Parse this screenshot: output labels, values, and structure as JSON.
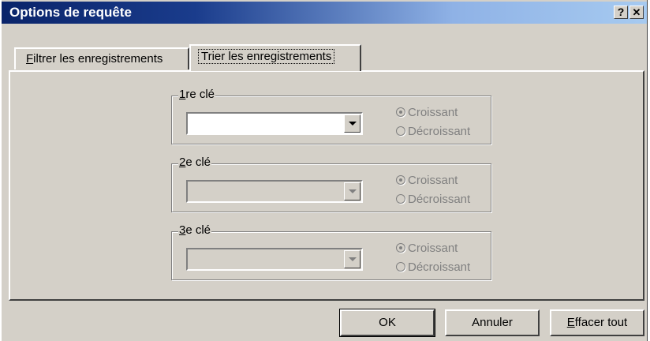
{
  "window": {
    "title": "Options de requête",
    "help_label": "?",
    "close_label": "✕"
  },
  "tabs": [
    {
      "pre": "",
      "mnemonic": "F",
      "post": "iltrer les enregistrements",
      "active": false
    },
    {
      "pre": "Trier les enre",
      "mnemonic": "g",
      "post": "istrements",
      "active": true
    }
  ],
  "sort_keys": [
    {
      "mnemonic": "1",
      "label_rest": "re clé",
      "value": "",
      "enabled": true,
      "options": [
        "Croissant",
        "Décroissant"
      ],
      "selected": "Croissant"
    },
    {
      "mnemonic": "2",
      "label_rest": "e clé",
      "value": "",
      "enabled": false,
      "options": [
        "Croissant",
        "Décroissant"
      ],
      "selected": "Croissant"
    },
    {
      "mnemonic": "3",
      "label_rest": "e clé",
      "value": "",
      "enabled": false,
      "options": [
        "Croissant",
        "Décroissant"
      ],
      "selected": "Croissant"
    }
  ],
  "buttons": {
    "ok": "OK",
    "cancel": "Annuler",
    "clear_mnemonic": "E",
    "clear_rest": "ffacer tout"
  },
  "colors": {
    "face": "#d4d0c8",
    "title_start": "#0a246a",
    "title_end": "#a6caf0",
    "disabled_text": "#808080"
  }
}
